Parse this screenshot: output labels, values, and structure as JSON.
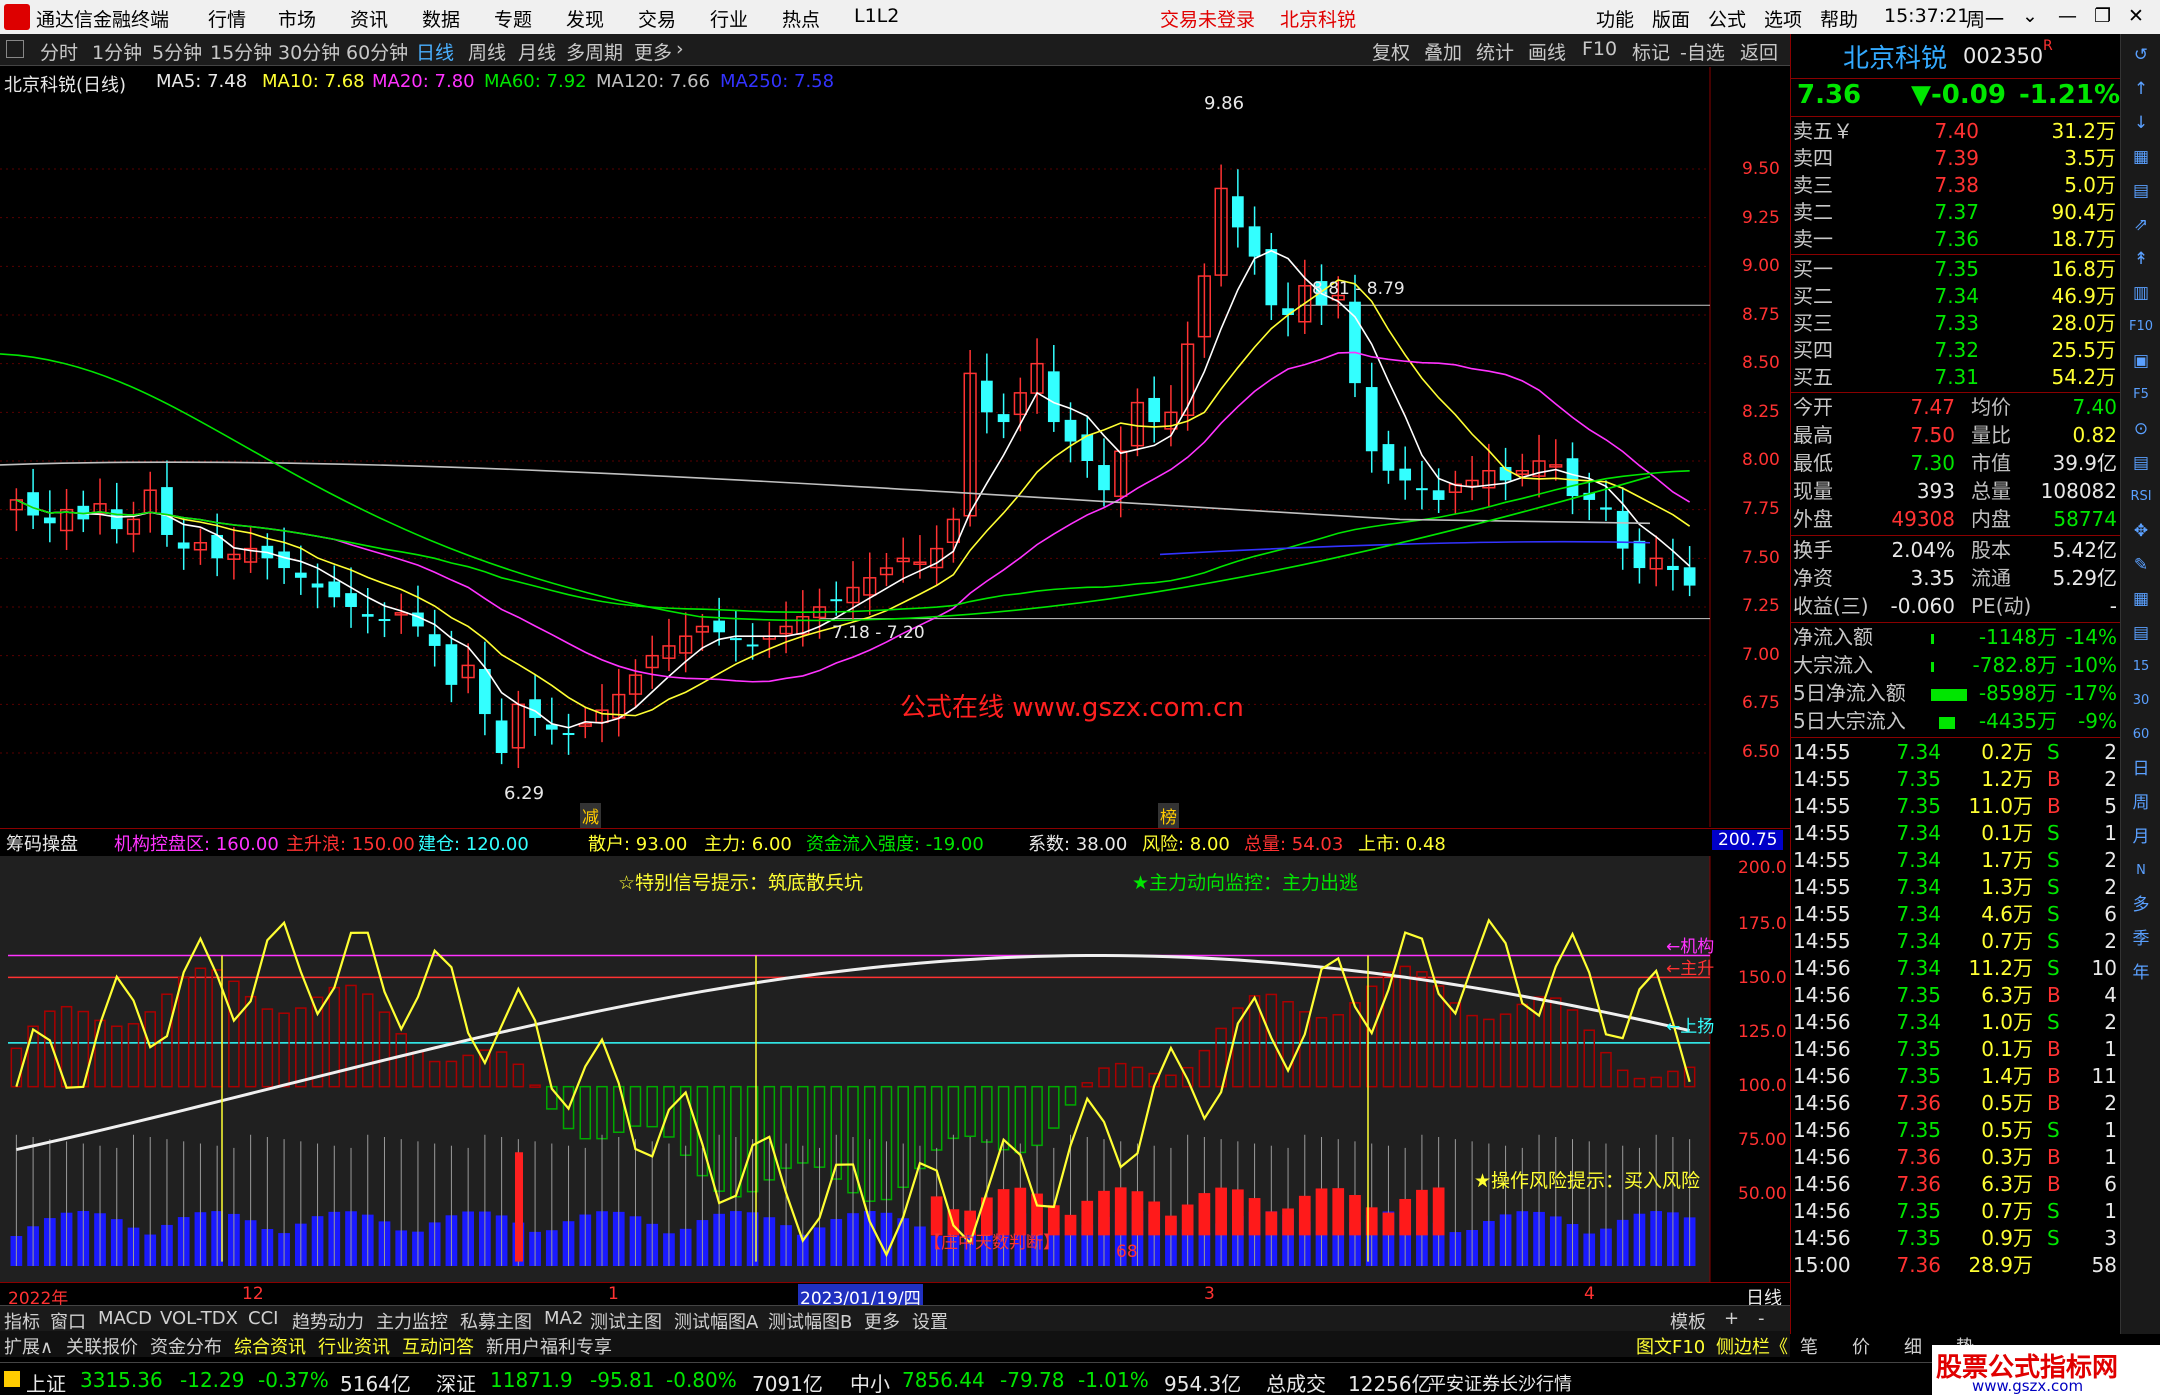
{
  "titlebar": {
    "app_title": "通达信金融终端",
    "menus": [
      "行情",
      "市场",
      "资讯",
      "数据",
      "专题",
      "发现",
      "交易",
      "行业",
      "热点",
      "L1L2"
    ],
    "trade_status": "交易未登录",
    "stock_name": "北京科锐",
    "right_menus": [
      "功能",
      "版面",
      "公式",
      "选项",
      "帮助"
    ],
    "clock": "15:37:21",
    "weekday": "周一"
  },
  "periodbar": {
    "periods": [
      "分时",
      "1分钟",
      "5分钟",
      "15分钟",
      "30分钟",
      "60分钟",
      "日线",
      "周线",
      "月线",
      "多周期",
      "更多"
    ],
    "active": "日线",
    "tools": [
      "复权",
      "叠加",
      "统计",
      "画线",
      "F10",
      "标记",
      "-自选",
      "返回"
    ]
  },
  "main_chart": {
    "legend": {
      "title": "北京科锐(日线)",
      "ma5": "MA5: 7.48",
      "ma10": "MA10: 7.68",
      "ma20": "MA20: 7.80",
      "ma60": "MA60: 7.92",
      "ma120": "MA120: 7.66",
      "ma250": "MA250: 7.58"
    },
    "price_axis": [
      "9.50",
      "9.25",
      "9.00",
      "8.75",
      "8.50",
      "8.25",
      "8.00",
      "7.75",
      "7.50",
      "7.25",
      "7.00",
      "6.75",
      "6.50"
    ],
    "annotations": {
      "high": "9.86",
      "low": "6.29",
      "level_high": "8.81 - 8.79",
      "level_low": "7.18 - 7.20",
      "watermark": "公式在线  www.gszx.com.cn",
      "tag_jian": "减",
      "tag_bang": "榜"
    },
    "colors": {
      "up": "#ff3232",
      "down": "#33ffff",
      "ma5": "#ffffff",
      "ma10": "#ffff33",
      "ma20": "#ff33ff",
      "ma60": "#00e600",
      "ma120": "#c0c0c0",
      "ma250": "#3333ff"
    }
  },
  "sub_chart": {
    "legend": {
      "name": "筹码操盘",
      "jigou": "机构控盘区: 160.00",
      "zhusheng": "主升浪: 150.00",
      "jiancang": "建仓: 120.00",
      "sanhu": "散户: 93.00",
      "zhuli": "主力: 6.00",
      "zijin": "资金流入强度: -19.00",
      "xishu": "系数: 38.00",
      "fengxian": "风险: 8.00",
      "zongliang": "总量: 54.03",
      "shangshi": "上市: 0.48",
      "badge": "200.75"
    },
    "axis": [
      "200.0",
      "175.0",
      "150.0",
      "125.0",
      "100.0",
      "75.00",
      "50.00"
    ],
    "labels": {
      "signal": "☆特别信号提示：筑底散兵坑",
      "monitor": "★主力动向监控：主力出逃",
      "risk": "★操作风险提示：买入风险",
      "judge": "【庄中天数判断】",
      "count": "68",
      "jigou_tag": "←机构",
      "zhu_tag": "←主升",
      "shang_tag": "←上扬"
    },
    "date_axis": [
      "2022年",
      "12",
      "1",
      "2023/01/19/四",
      "3",
      "4"
    ],
    "period_label": "日线"
  },
  "tabs_row1": [
    "指标",
    "窗口",
    "MACD",
    "VOL-TDX",
    "CCI",
    "趋势动力",
    "主力监控",
    "私募主图",
    "MA2",
    "测试主图",
    "测试幅图A",
    "测试幅图B",
    "更多",
    "设置"
  ],
  "tabs_row1_right": [
    "模板",
    "+",
    "-"
  ],
  "tabs_row2": [
    "扩展∧",
    "关联报价",
    "资金分布",
    "综合资讯",
    "行业资讯",
    "互动问答",
    "新用户福利专享"
  ],
  "tabs_row2_right": [
    "图文F10",
    "侧边栏《",
    "笔",
    "价",
    "细",
    "势"
  ],
  "quote": {
    "name": "北京科锐",
    "code": "002350",
    "r_mark": "R",
    "price": "7.36",
    "change": "▼-0.09",
    "pct": "-1.21%",
    "asks": [
      {
        "label": "卖五￥",
        "price": "7.40",
        "vol": "31.2万"
      },
      {
        "label": "卖四",
        "price": "7.39",
        "vol": "3.5万"
      },
      {
        "label": "卖三",
        "price": "7.38",
        "vol": "5.0万"
      },
      {
        "label": "卖二",
        "price": "7.37",
        "vol": "90.4万"
      },
      {
        "label": "卖一",
        "price": "7.36",
        "vol": "18.7万"
      }
    ],
    "bids": [
      {
        "label": "买一",
        "price": "7.35",
        "vol": "16.8万"
      },
      {
        "label": "买二",
        "price": "7.34",
        "vol": "46.9万"
      },
      {
        "label": "买三",
        "price": "7.33",
        "vol": "28.0万"
      },
      {
        "label": "买四",
        "price": "7.32",
        "vol": "25.5万"
      },
      {
        "label": "买五",
        "price": "7.31",
        "vol": "54.2万"
      }
    ],
    "stats1": [
      {
        "l1": "今开",
        "v1": "7.47",
        "l2": "均价",
        "v2": "7.40"
      },
      {
        "l1": "最高",
        "v1": "7.50",
        "l2": "量比",
        "v2": "0.82"
      },
      {
        "l1": "最低",
        "v1": "7.30",
        "l2": "市值",
        "v2": "39.9亿"
      },
      {
        "l1": "现量",
        "v1": "393",
        "l2": "总量",
        "v2": "108082"
      },
      {
        "l1": "外盘",
        "v1": "49308",
        "l2": "内盘",
        "v2": "58774"
      }
    ],
    "stats2": [
      {
        "l1": "换手",
        "v1": "2.04%",
        "l2": "股本",
        "v2": "5.42亿"
      },
      {
        "l1": "净资",
        "v1": "3.35",
        "l2": "流通",
        "v2": "5.29亿"
      },
      {
        "l1": "收益(三)",
        "v1": "-0.060",
        "l2": "PE(动)",
        "v2": "-"
      }
    ],
    "flows": [
      {
        "label": "净流入额",
        "value": "-1148万",
        "pct": "-14%"
      },
      {
        "label": "大宗流入",
        "value": "-782.8万",
        "pct": "-10%"
      },
      {
        "label": "5日净流入额",
        "value": "-8598万",
        "pct": "-17%"
      },
      {
        "label": "5日大宗流入",
        "value": "-4435万",
        "pct": "-9%"
      }
    ],
    "ticks": [
      {
        "t": "14:55",
        "p": "7.34",
        "v": "0.2万",
        "s": "S",
        "n": "2"
      },
      {
        "t": "14:55",
        "p": "7.35",
        "v": "1.2万",
        "s": "B",
        "n": "2"
      },
      {
        "t": "14:55",
        "p": "7.35",
        "v": "11.0万",
        "s": "B",
        "n": "5"
      },
      {
        "t": "14:55",
        "p": "7.34",
        "v": "0.1万",
        "s": "S",
        "n": "1"
      },
      {
        "t": "14:55",
        "p": "7.34",
        "v": "1.7万",
        "s": "S",
        "n": "2"
      },
      {
        "t": "14:55",
        "p": "7.34",
        "v": "1.3万",
        "s": "S",
        "n": "2"
      },
      {
        "t": "14:55",
        "p": "7.34",
        "v": "4.6万",
        "s": "S",
        "n": "6"
      },
      {
        "t": "14:55",
        "p": "7.34",
        "v": "0.7万",
        "s": "S",
        "n": "2"
      },
      {
        "t": "14:56",
        "p": "7.34",
        "v": "11.2万",
        "s": "S",
        "n": "10"
      },
      {
        "t": "14:56",
        "p": "7.35",
        "v": "6.3万",
        "s": "B",
        "n": "4"
      },
      {
        "t": "14:56",
        "p": "7.34",
        "v": "1.0万",
        "s": "S",
        "n": "2"
      },
      {
        "t": "14:56",
        "p": "7.35",
        "v": "0.1万",
        "s": "B",
        "n": "1"
      },
      {
        "t": "14:56",
        "p": "7.35",
        "v": "1.4万",
        "s": "B",
        "n": "11"
      },
      {
        "t": "14:56",
        "p": "7.36",
        "v": "0.5万",
        "s": "B",
        "n": "2"
      },
      {
        "t": "14:56",
        "p": "7.35",
        "v": "0.5万",
        "s": "S",
        "n": "1"
      },
      {
        "t": "14:56",
        "p": "7.36",
        "v": "0.3万",
        "s": "B",
        "n": "1"
      },
      {
        "t": "14:56",
        "p": "7.36",
        "v": "6.3万",
        "s": "B",
        "n": "6"
      },
      {
        "t": "14:56",
        "p": "7.35",
        "v": "0.7万",
        "s": "S",
        "n": "1"
      },
      {
        "t": "14:56",
        "p": "7.35",
        "v": "0.9万",
        "s": "S",
        "n": "3"
      },
      {
        "t": "15:00",
        "p": "7.36",
        "v": "28.9万",
        "s": "",
        "n": "58"
      }
    ]
  },
  "side_icons": [
    "↺",
    "↑",
    "↓",
    "▦",
    "▤",
    "⇗",
    "↟",
    "▥",
    "F10",
    "▣",
    "F5",
    "⊙",
    "▤",
    "RSI",
    "✥",
    "✎",
    "▦",
    "▤",
    "15",
    "30",
    "60",
    "日",
    "周",
    "月",
    "N",
    "多",
    "季",
    "年"
  ],
  "statusbar": {
    "sh_name": "上证",
    "sh_val": "3315.36",
    "sh_chg": "-12.29",
    "sh_pct": "-0.37%",
    "sh_amt": "5164亿",
    "sz_name": "深证",
    "sz_val": "11871.9",
    "sz_chg": "-95.81",
    "sz_pct": "-0.80%",
    "sz_amt": "7091亿",
    "zx_name": "中小",
    "zx_val": "7856.44",
    "zx_chg": "-79.78",
    "zx_pct": "-1.01%",
    "zx_amt": "954.3亿",
    "total_label": "总成交",
    "total_val": "12256亿",
    "broker": "平安证券长沙行情",
    "brand": "股票公式指标网",
    "brand_url": "www.gszx.com"
  }
}
